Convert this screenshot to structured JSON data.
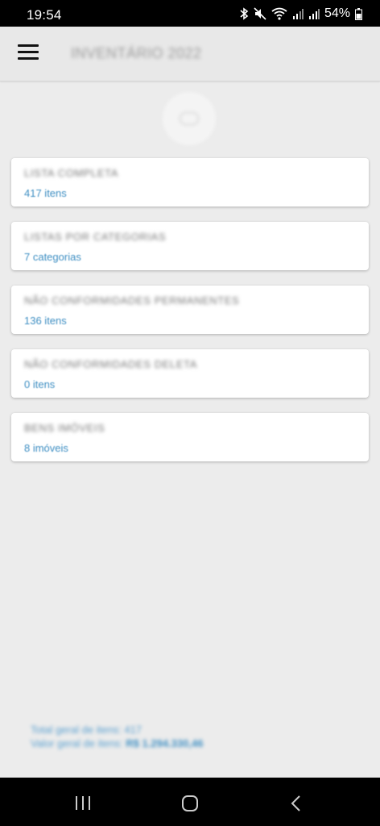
{
  "status_bar": {
    "time": "19:54",
    "battery_percent": "54%",
    "icons": [
      "bluetooth-icon",
      "mute-icon",
      "wifi-icon",
      "signal-icon",
      "signal-icon",
      "battery-icon"
    ]
  },
  "header": {
    "title": "INVENTÁRIO 2022",
    "menu_icon": "hamburger-menu-icon"
  },
  "cards": [
    {
      "title": "LISTA COMPLETA",
      "subtitle": "417 itens"
    },
    {
      "title": "LISTAS POR CATEGORIAS",
      "subtitle": "7 categorias"
    },
    {
      "title": "NÃO CONFORMIDADES PERMANENTES",
      "subtitle": "136 itens"
    },
    {
      "title": "NÃO CONFORMIDADES DELETA",
      "subtitle": "0 itens"
    },
    {
      "title": "BENS IMÓVEIS",
      "subtitle": "8 imóveis"
    }
  ],
  "footer": {
    "line1": "Total geral de itens: 417",
    "line2_label": "Valor geral de itens:",
    "line2_value": "R$ 1.294.330,46"
  },
  "nav_bar": {
    "icons": [
      "recent-apps-icon",
      "home-icon",
      "back-icon"
    ]
  },
  "colors": {
    "accent": "#3f8fc3",
    "background": "#ececec",
    "card": "#ffffff"
  }
}
